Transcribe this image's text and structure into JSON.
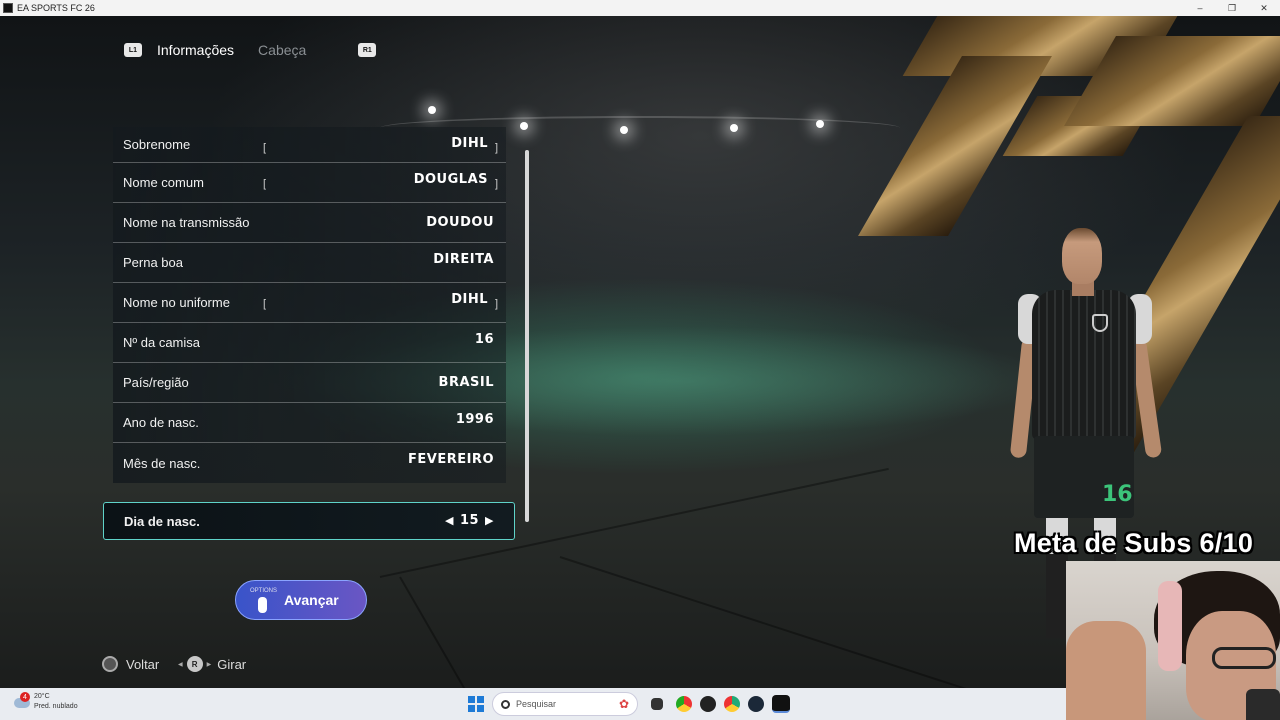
{
  "window": {
    "title": "EA SPORTS FC 26",
    "controls": [
      "–",
      "❐",
      "✕"
    ]
  },
  "tabs": {
    "left_button": "L1",
    "right_button": "R1",
    "items": [
      {
        "label": "Informações",
        "active": true
      },
      {
        "label": "Cabeça",
        "active": false
      }
    ]
  },
  "form": {
    "rows": [
      {
        "label": "Sobrenome",
        "value": "DIHL",
        "bracket_left": "[",
        "bracket_right": "]"
      },
      {
        "label": "Nome comum",
        "value": "DOUGLAS",
        "bracket_left": "[",
        "bracket_right": "]"
      },
      {
        "label": "Nome na transmissão",
        "value": "DOUDOU"
      },
      {
        "label": "Perna boa",
        "value": "DIREITA"
      },
      {
        "label": "Nome no uniforme",
        "value": "DIHL",
        "bracket_left": "[",
        "bracket_right": "]"
      },
      {
        "label": "Nº da camisa",
        "value": "16"
      },
      {
        "label": "País/região",
        "value": "BRASIL"
      },
      {
        "label": "Ano de nasc.",
        "value": "1996"
      },
      {
        "label": "Mês de nasc.",
        "value": "FEVEREIRO"
      }
    ],
    "selected": {
      "label": "Dia de nasc.",
      "value": "15",
      "arrow_left": "◀",
      "arrow_right": "▶"
    }
  },
  "advance_button": {
    "options_label": "OPTIONS",
    "label": "Avançar"
  },
  "hints": {
    "back": {
      "label": "Voltar"
    },
    "rotate": {
      "stick": "R",
      "label": "Girar"
    }
  },
  "player": {
    "shorts_number": "16"
  },
  "overlay": {
    "subs_goal": "Meta de Subs 6/10"
  },
  "taskbar": {
    "weather": {
      "temp": "20°C",
      "desc": "Pred. nublado",
      "badge": "4"
    },
    "search_placeholder": "Pesquisar",
    "apps": [
      "file-explorer-icon",
      "chrome-icon",
      "app-icon",
      "chrome-alt-icon",
      "steam-icon",
      "ea-icon"
    ]
  },
  "colors": {
    "accent": "#5fd3c9",
    "advance_start": "#3954c9",
    "advance_end": "#6a56c4",
    "number_green": "#3cc47a"
  }
}
